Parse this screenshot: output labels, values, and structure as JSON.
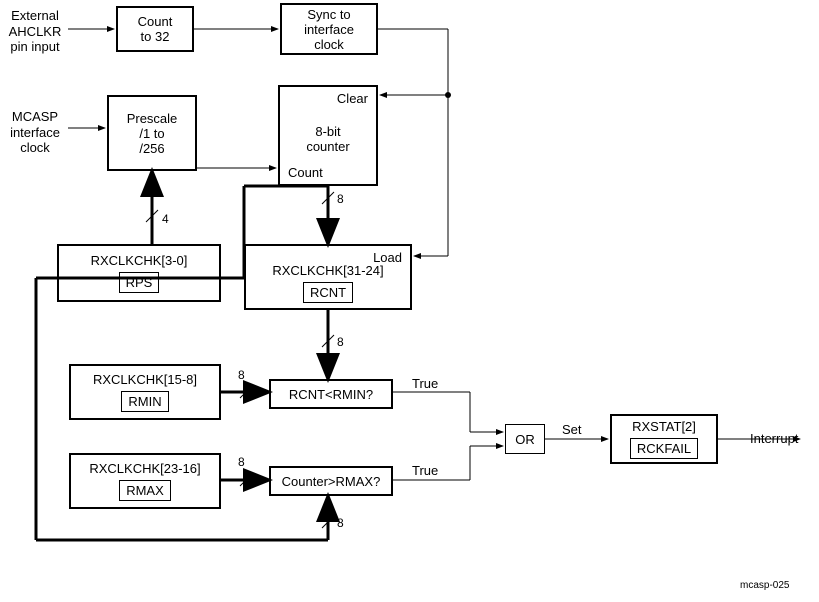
{
  "inputs": {
    "ahclkr": "External\nAHCLKR\npin input",
    "mcasp": "MCASP\ninterface\nclock"
  },
  "count32": "Count\nto 32",
  "sync": "Sync to\ninterface\nclock",
  "prescale": "Prescale\n/1 to\n/256",
  "counter8": {
    "clear": "Clear",
    "body": "8-bit\ncounter",
    "count": "Count"
  },
  "rxclkchk_3_0": {
    "title": "RXCLKCHK[3-0]",
    "field": "RPS"
  },
  "rxclkchk_31_24": {
    "load": "Load",
    "title": "RXCLKCHK[31-24]",
    "field": "RCNT"
  },
  "rxclkchk_15_8": {
    "title": "RXCLKCHK[15-8]",
    "field": "RMIN"
  },
  "rxclkchk_23_16": {
    "title": "RXCLKCHK[23-16]",
    "field": "RMAX"
  },
  "cmp_min": "RCNT<RMIN?",
  "cmp_max": "Counter>RMAX?",
  "or": "OR",
  "set": "Set",
  "true": "True",
  "rxstat": {
    "title": "RXSTAT[2]",
    "field": "RCKFAIL"
  },
  "interrupt": "Interrupt",
  "bus4": "4",
  "bus8a": "8",
  "bus8b": "8",
  "bus8c": "8",
  "bus8d": "8",
  "bus8e": "8",
  "footer": "mcasp-025"
}
